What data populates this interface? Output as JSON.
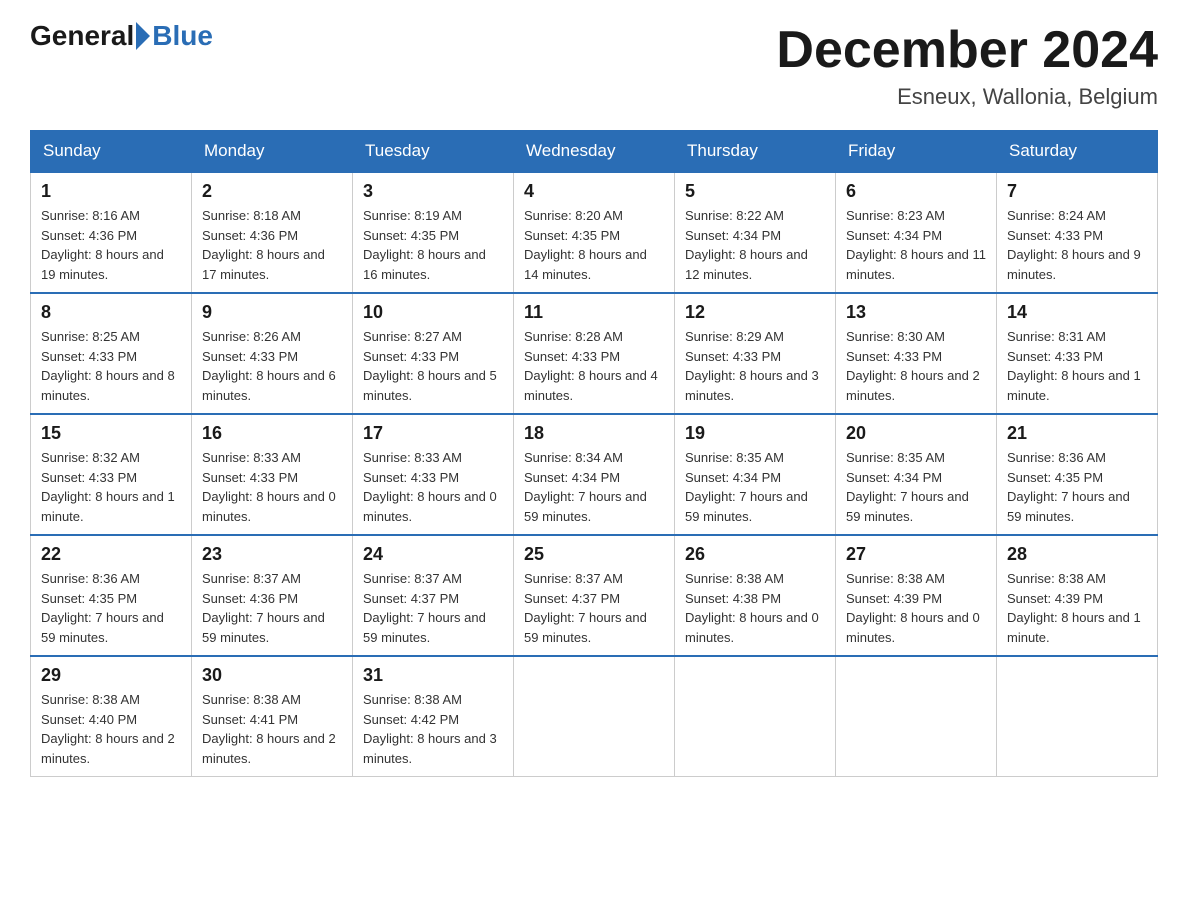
{
  "logo": {
    "text_before": "General",
    "text_after": "Blue"
  },
  "title": "December 2024",
  "subtitle": "Esneux, Wallonia, Belgium",
  "days_of_week": [
    "Sunday",
    "Monday",
    "Tuesday",
    "Wednesday",
    "Thursday",
    "Friday",
    "Saturday"
  ],
  "weeks": [
    [
      {
        "day": "1",
        "sunrise": "8:16 AM",
        "sunset": "4:36 PM",
        "daylight": "8 hours and 19 minutes."
      },
      {
        "day": "2",
        "sunrise": "8:18 AM",
        "sunset": "4:36 PM",
        "daylight": "8 hours and 17 minutes."
      },
      {
        "day": "3",
        "sunrise": "8:19 AM",
        "sunset": "4:35 PM",
        "daylight": "8 hours and 16 minutes."
      },
      {
        "day": "4",
        "sunrise": "8:20 AM",
        "sunset": "4:35 PM",
        "daylight": "8 hours and 14 minutes."
      },
      {
        "day": "5",
        "sunrise": "8:22 AM",
        "sunset": "4:34 PM",
        "daylight": "8 hours and 12 minutes."
      },
      {
        "day": "6",
        "sunrise": "8:23 AM",
        "sunset": "4:34 PM",
        "daylight": "8 hours and 11 minutes."
      },
      {
        "day": "7",
        "sunrise": "8:24 AM",
        "sunset": "4:33 PM",
        "daylight": "8 hours and 9 minutes."
      }
    ],
    [
      {
        "day": "8",
        "sunrise": "8:25 AM",
        "sunset": "4:33 PM",
        "daylight": "8 hours and 8 minutes."
      },
      {
        "day": "9",
        "sunrise": "8:26 AM",
        "sunset": "4:33 PM",
        "daylight": "8 hours and 6 minutes."
      },
      {
        "day": "10",
        "sunrise": "8:27 AM",
        "sunset": "4:33 PM",
        "daylight": "8 hours and 5 minutes."
      },
      {
        "day": "11",
        "sunrise": "8:28 AM",
        "sunset": "4:33 PM",
        "daylight": "8 hours and 4 minutes."
      },
      {
        "day": "12",
        "sunrise": "8:29 AM",
        "sunset": "4:33 PM",
        "daylight": "8 hours and 3 minutes."
      },
      {
        "day": "13",
        "sunrise": "8:30 AM",
        "sunset": "4:33 PM",
        "daylight": "8 hours and 2 minutes."
      },
      {
        "day": "14",
        "sunrise": "8:31 AM",
        "sunset": "4:33 PM",
        "daylight": "8 hours and 1 minute."
      }
    ],
    [
      {
        "day": "15",
        "sunrise": "8:32 AM",
        "sunset": "4:33 PM",
        "daylight": "8 hours and 1 minute."
      },
      {
        "day": "16",
        "sunrise": "8:33 AM",
        "sunset": "4:33 PM",
        "daylight": "8 hours and 0 minutes."
      },
      {
        "day": "17",
        "sunrise": "8:33 AM",
        "sunset": "4:33 PM",
        "daylight": "8 hours and 0 minutes."
      },
      {
        "day": "18",
        "sunrise": "8:34 AM",
        "sunset": "4:34 PM",
        "daylight": "7 hours and 59 minutes."
      },
      {
        "day": "19",
        "sunrise": "8:35 AM",
        "sunset": "4:34 PM",
        "daylight": "7 hours and 59 minutes."
      },
      {
        "day": "20",
        "sunrise": "8:35 AM",
        "sunset": "4:34 PM",
        "daylight": "7 hours and 59 minutes."
      },
      {
        "day": "21",
        "sunrise": "8:36 AM",
        "sunset": "4:35 PM",
        "daylight": "7 hours and 59 minutes."
      }
    ],
    [
      {
        "day": "22",
        "sunrise": "8:36 AM",
        "sunset": "4:35 PM",
        "daylight": "7 hours and 59 minutes."
      },
      {
        "day": "23",
        "sunrise": "8:37 AM",
        "sunset": "4:36 PM",
        "daylight": "7 hours and 59 minutes."
      },
      {
        "day": "24",
        "sunrise": "8:37 AM",
        "sunset": "4:37 PM",
        "daylight": "7 hours and 59 minutes."
      },
      {
        "day": "25",
        "sunrise": "8:37 AM",
        "sunset": "4:37 PM",
        "daylight": "7 hours and 59 minutes."
      },
      {
        "day": "26",
        "sunrise": "8:38 AM",
        "sunset": "4:38 PM",
        "daylight": "8 hours and 0 minutes."
      },
      {
        "day": "27",
        "sunrise": "8:38 AM",
        "sunset": "4:39 PM",
        "daylight": "8 hours and 0 minutes."
      },
      {
        "day": "28",
        "sunrise": "8:38 AM",
        "sunset": "4:39 PM",
        "daylight": "8 hours and 1 minute."
      }
    ],
    [
      {
        "day": "29",
        "sunrise": "8:38 AM",
        "sunset": "4:40 PM",
        "daylight": "8 hours and 2 minutes."
      },
      {
        "day": "30",
        "sunrise": "8:38 AM",
        "sunset": "4:41 PM",
        "daylight": "8 hours and 2 minutes."
      },
      {
        "day": "31",
        "sunrise": "8:38 AM",
        "sunset": "4:42 PM",
        "daylight": "8 hours and 3 minutes."
      },
      null,
      null,
      null,
      null
    ]
  ],
  "labels": {
    "sunrise": "Sunrise:",
    "sunset": "Sunset:",
    "daylight": "Daylight:"
  }
}
